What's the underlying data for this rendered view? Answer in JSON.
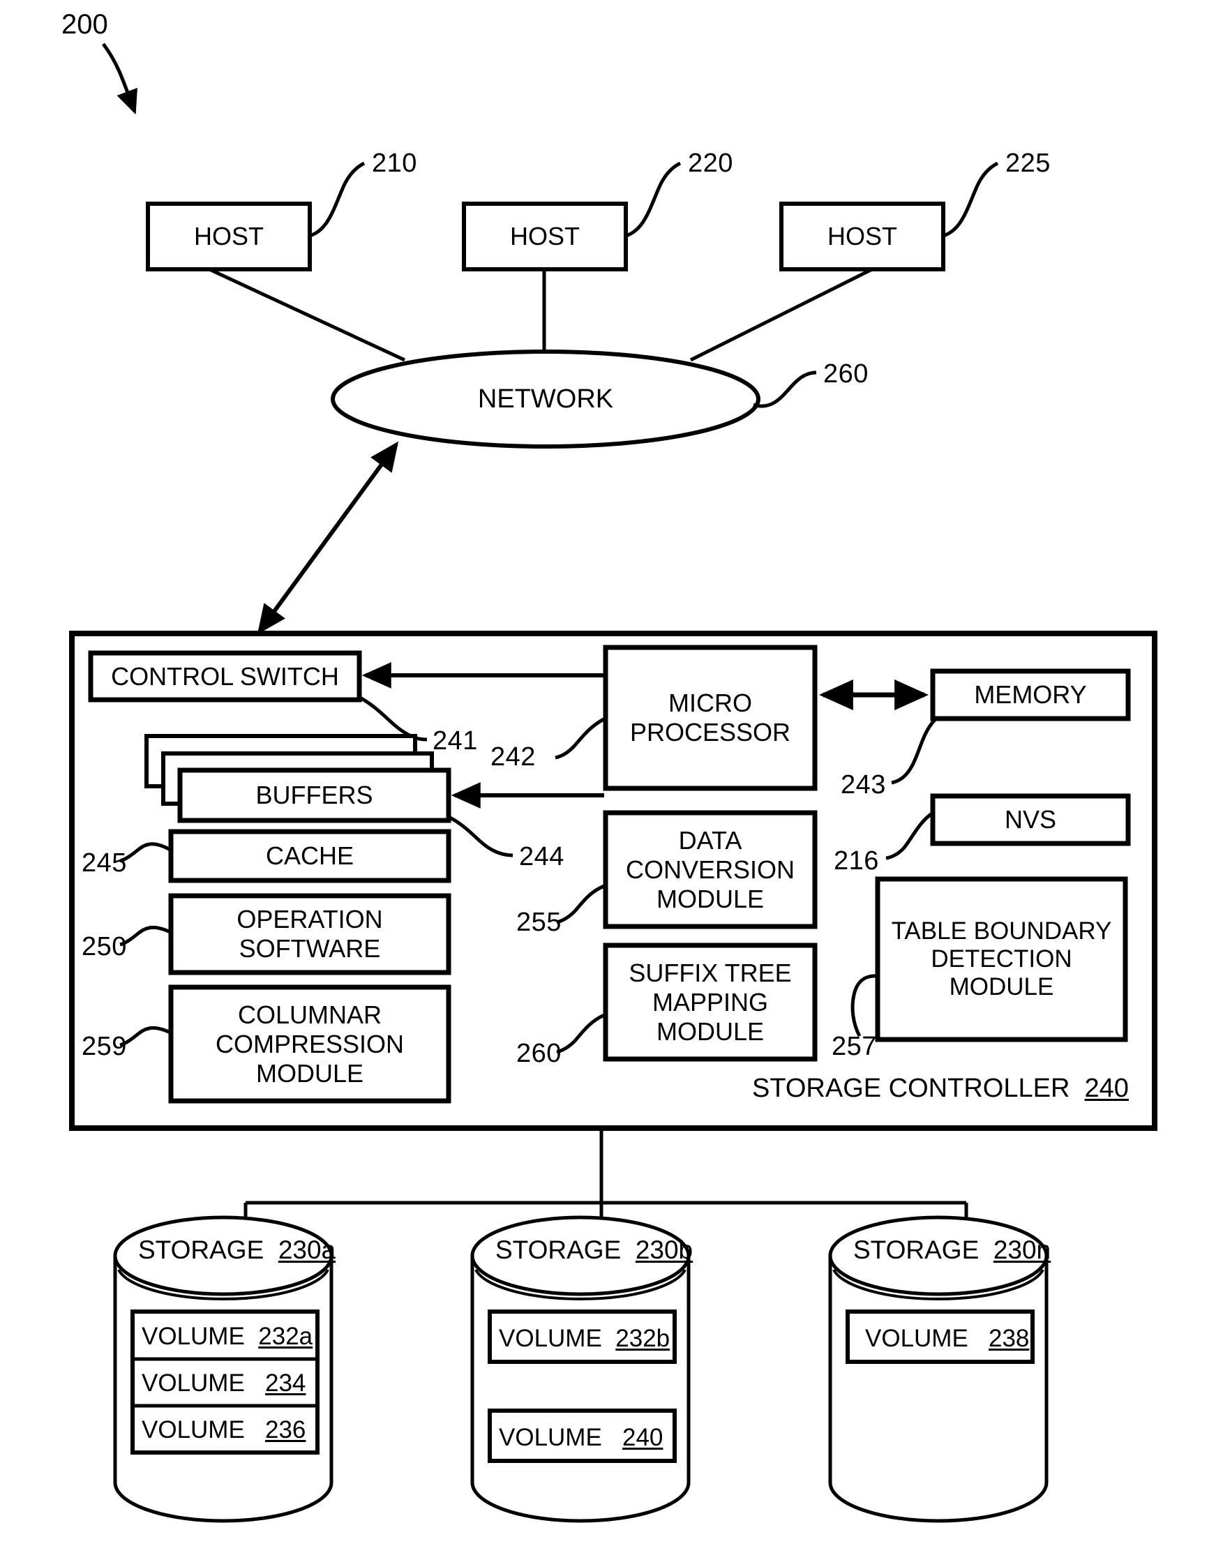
{
  "figure": {
    "number": "200",
    "title": "Storage system block diagram"
  },
  "hosts": [
    {
      "label": "HOST",
      "ref": "210"
    },
    {
      "label": "HOST",
      "ref": "220"
    },
    {
      "label": "HOST",
      "ref": "225"
    }
  ],
  "network": {
    "label": "NETWORK",
    "ref": "260"
  },
  "storage_controller": {
    "label": "STORAGE CONTROLLER",
    "ref": "240",
    "components": [
      {
        "name": "control-switch",
        "label": "CONTROL SWITCH",
        "ref": "241"
      },
      {
        "name": "buffers",
        "label": "BUFFERS",
        "ref": "244"
      },
      {
        "name": "cache",
        "label": "CACHE",
        "ref": "245"
      },
      {
        "name": "operation-software",
        "label": "OPERATION SOFTWARE",
        "lines": [
          "OPERATION",
          "SOFTWARE"
        ],
        "ref": "250"
      },
      {
        "name": "columnar-compression-module",
        "label": "COLUMNAR COMPRESSION MODULE",
        "lines": [
          "COLUMNAR",
          "COMPRESSION",
          "MODULE"
        ],
        "ref": "259"
      },
      {
        "name": "micro-processor",
        "label": "MICRO PROCESSOR",
        "lines": [
          "MICRO",
          "PROCESSOR"
        ],
        "ref": "242"
      },
      {
        "name": "data-conversion-module",
        "label": "DATA CONVERSION MODULE",
        "lines": [
          "DATA",
          "CONVERSION",
          "MODULE"
        ],
        "ref": "255"
      },
      {
        "name": "suffix-tree-mapping-module",
        "label": "SUFFIX TREE MAPPING MODULE",
        "lines": [
          "SUFFIX TREE",
          "MAPPING",
          "MODULE"
        ],
        "ref": "260"
      },
      {
        "name": "memory",
        "label": "MEMORY",
        "ref": "243"
      },
      {
        "name": "nvs",
        "label": "NVS",
        "ref": "216"
      },
      {
        "name": "table-boundary-detection-module",
        "label": "TABLE BOUNDARY DETECTION MODULE",
        "lines": [
          "TABLE BOUNDARY",
          "DETECTION",
          "MODULE"
        ],
        "ref": "257"
      }
    ]
  },
  "storages": [
    {
      "label": "STORAGE",
      "ref": "230a",
      "volumes": [
        {
          "label": "VOLUME",
          "ref": "232a"
        },
        {
          "label": "VOLUME",
          "ref": "234"
        },
        {
          "label": "VOLUME",
          "ref": "236"
        }
      ]
    },
    {
      "label": "STORAGE",
      "ref": "230b",
      "volumes": [
        {
          "label": "VOLUME",
          "ref": "232b"
        },
        {
          "label": "VOLUME",
          "ref": "240"
        }
      ]
    },
    {
      "label": "STORAGE",
      "ref": "230n",
      "volumes": [
        {
          "label": "VOLUME",
          "ref": "238"
        }
      ]
    }
  ],
  "colors": {
    "stroke": "#000000",
    "background": "#ffffff"
  }
}
